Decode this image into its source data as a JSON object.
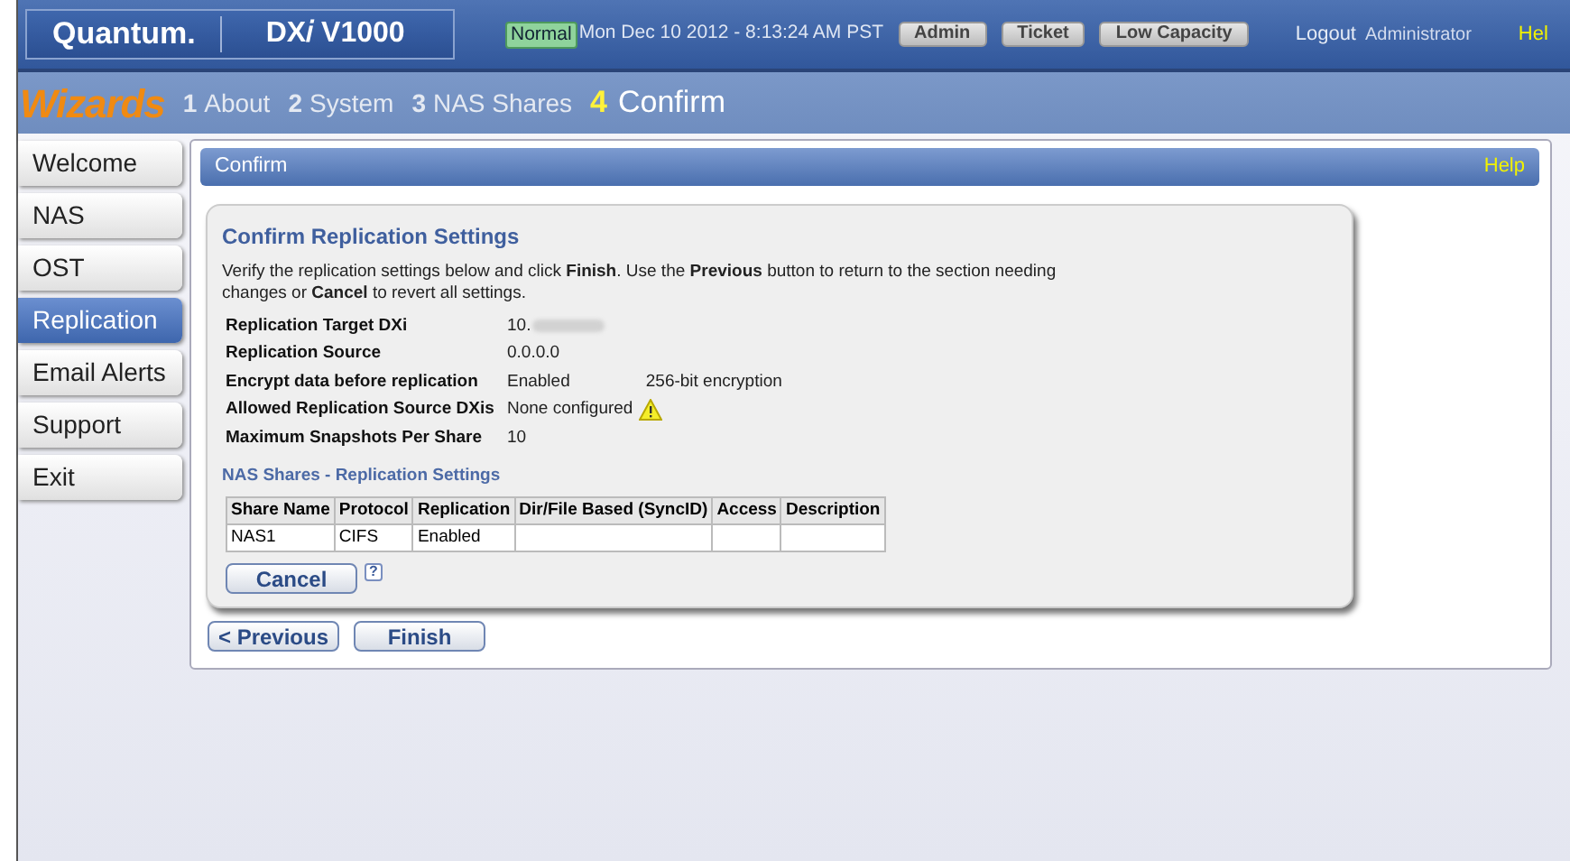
{
  "header": {
    "brand": "Quantum.",
    "product": "DX𝑖 V1000",
    "status": "Normal",
    "datetime": "Mon Dec 10 2012 - 8:13:24 AM PST",
    "buttons": [
      "Admin",
      "Ticket",
      "Low Capacity"
    ],
    "logout": "Logout",
    "user": "Administrator",
    "help": "Hel"
  },
  "wizard": {
    "title": "Wizards",
    "steps": [
      {
        "number": "1",
        "label": "About",
        "selected": false
      },
      {
        "number": "2",
        "label": "System",
        "selected": false
      },
      {
        "number": "3",
        "label": "NAS Shares",
        "selected": false
      },
      {
        "number": "4",
        "label": "Confirm",
        "selected": true
      }
    ]
  },
  "sidebar": {
    "items": [
      {
        "label": "Welcome",
        "selected": false
      },
      {
        "label": "NAS",
        "selected": false
      },
      {
        "label": "OST",
        "selected": false
      },
      {
        "label": "Replication",
        "selected": true
      },
      {
        "label": "Email Alerts",
        "selected": false
      },
      {
        "label": "Support",
        "selected": false
      },
      {
        "label": "Exit",
        "selected": false
      }
    ]
  },
  "panel": {
    "title": "Confirm",
    "help": "Help"
  },
  "section": {
    "title": "Confirm Replication Settings",
    "intro": "Verify the replication settings below and click **Finish**. Use the **Previous** button to return to the section needing changes or **Cancel** to revert all settings.",
    "settings": [
      {
        "label": "Replication Target DXi",
        "value": "10.",
        "redacted": true
      },
      {
        "label": "Replication Source",
        "value": "0.0.0.0",
        "redacted": false
      },
      {
        "label": "Encrypt data before replication",
        "value": "Enabled",
        "extra": "256-bit encryption",
        "redacted": false
      },
      {
        "label": "Allowed Replication Source DXis",
        "value": "None configured",
        "warning": true,
        "redacted": false
      },
      {
        "label": "Maximum Snapshots Per Share",
        "value": "10",
        "redacted": false
      }
    ],
    "table": {
      "title": "NAS Shares - Replication Settings",
      "columns": [
        "Share Name",
        "Protocol",
        "Replication",
        "Dir/File Based (SyncID)",
        "Access",
        "Description"
      ],
      "rows": [
        [
          "NAS1",
          "CIFS",
          "Enabled",
          "",
          "",
          ""
        ]
      ]
    },
    "cancel": "Cancel",
    "help_mark": "?"
  },
  "footer_buttons": [
    "< Previous",
    "Finish"
  ]
}
